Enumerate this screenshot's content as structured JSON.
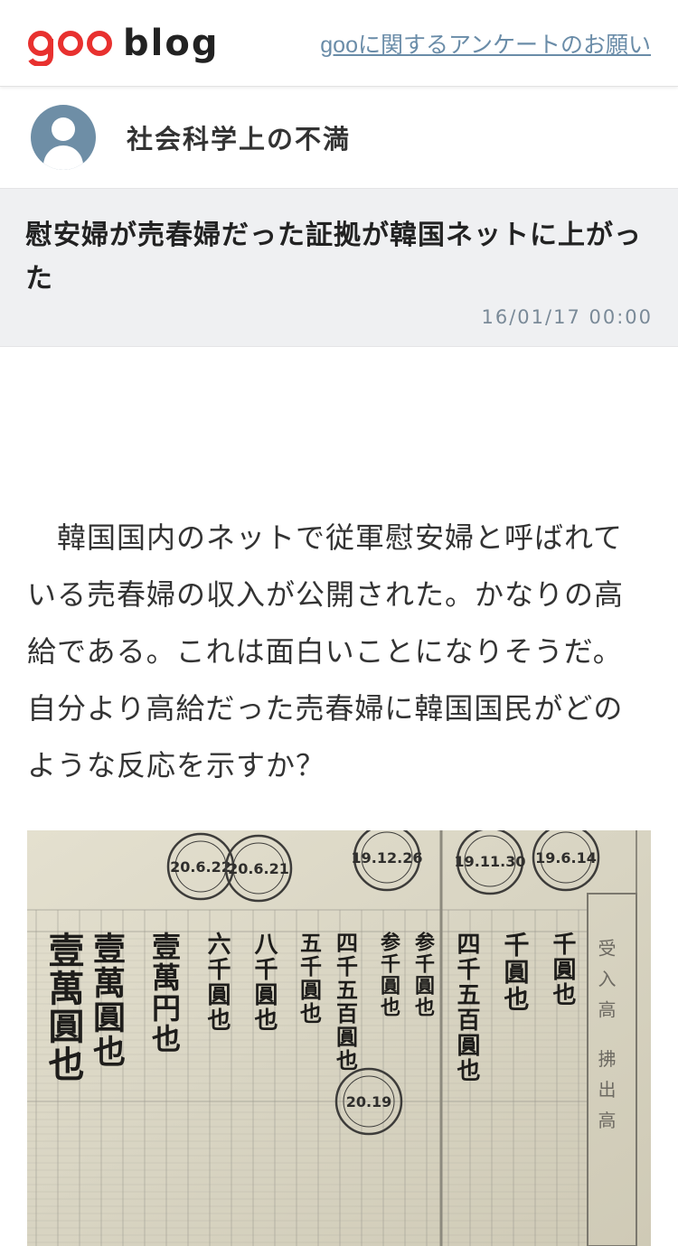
{
  "header": {
    "logo_word": "blog",
    "survey_link": "gooに関するアンケートのお願い"
  },
  "blog": {
    "title": "社会科学上の不満"
  },
  "article": {
    "title": "慰安婦が売春婦だった証拠が韓国ネットに上がった",
    "date": "16/01/17 00:00",
    "body": "　韓国国内のネットで従軍慰安婦と呼ばれている売春婦の収入が公開された。かなりの高給である。これは面白いことになりそうだ。自分より高給だった売春婦に韓国国民がどのような反応を示すか？"
  },
  "photo": {
    "stamps": [
      "20.6.22",
      "20.6.21",
      "19.12.26",
      "19.11.30",
      "19.6.14",
      "20.19"
    ],
    "columns": [
      "壹萬圓也",
      "壹萬圓也",
      "壹萬円也",
      "六千圓也",
      "八千圓也",
      "五千圓也",
      "四千五百圓也",
      "参千圓也",
      "参千圓也",
      "四千五百圓也",
      "千圓也",
      "千圓也"
    ],
    "side_label": "受入高 拂出高"
  },
  "colors": {
    "logo_red": "#e8312f",
    "link": "#6a8ca8",
    "avatar": "#6e8ea6",
    "article_head_bg": "#eff0f2"
  }
}
